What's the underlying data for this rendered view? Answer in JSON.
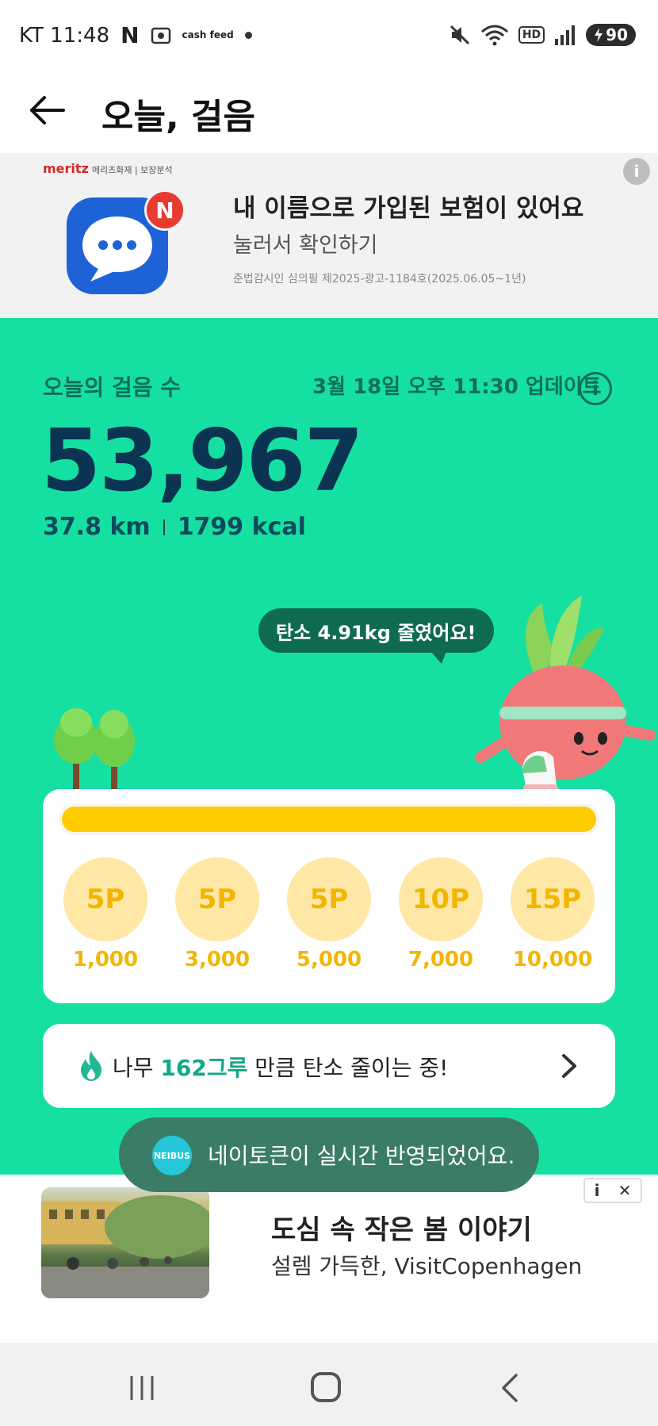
{
  "status_bar": {
    "carrier_time": "KT 11:48",
    "app_n": "N",
    "cashfeed": "cash feed",
    "hd": "HD",
    "battery": "90"
  },
  "header": {
    "title": "오늘, 걸음"
  },
  "top_ad": {
    "brand": "meritz",
    "brand_sub": "메리츠화재 | 보장분석",
    "badge": "N",
    "headline": "내 이름으로 가입된 보험이 있어요",
    "subline": "눌러서 확인하기",
    "disclaimer": "준법감시인 심의필 제2025-광고-1184호(2025.06.05~1년)",
    "info": "i"
  },
  "summary": {
    "label": "오늘의 걸음 수",
    "update": "3월 18일 오후 11:30 업데이트",
    "info": "i",
    "steps": "53,967",
    "distance": "37.8 km",
    "calories": "1799 kcal",
    "carbon_bubble": "탄소 4.91kg 줄였어요!"
  },
  "progress": {
    "fill_fraction": 1.0,
    "milestones": [
      {
        "points": "5P",
        "steps": "1,000"
      },
      {
        "points": "5P",
        "steps": "3,000"
      },
      {
        "points": "5P",
        "steps": "5,000"
      },
      {
        "points": "10P",
        "steps": "7,000"
      },
      {
        "points": "15P",
        "steps": "10,000"
      }
    ]
  },
  "tree_card": {
    "prefix": "나무 ",
    "highlight": "162그루",
    "suffix": " 만큼 탄소 줄이는 중!"
  },
  "toast": {
    "logo": "NEIBUS",
    "text": "네이토큰이 실시간 반영되었어요."
  },
  "bottom_ad": {
    "title": "도심 속 작은 봄 이야기",
    "subtitle": "설렘 가득한, VisitCopenhagen",
    "info": "i",
    "close": "✕"
  },
  "colors": {
    "main_green": "#16e0a1",
    "dark_green": "#0f6e5c",
    "steps_navy": "#0b3352",
    "gold": "#f2b600",
    "highlight_teal": "#12a988"
  },
  "icons": [
    "back-arrow-icon",
    "info-icon",
    "fire-icon",
    "chevron-right-icon",
    "mute-icon",
    "wifi-icon",
    "signal-icon",
    "battery-icon"
  ]
}
